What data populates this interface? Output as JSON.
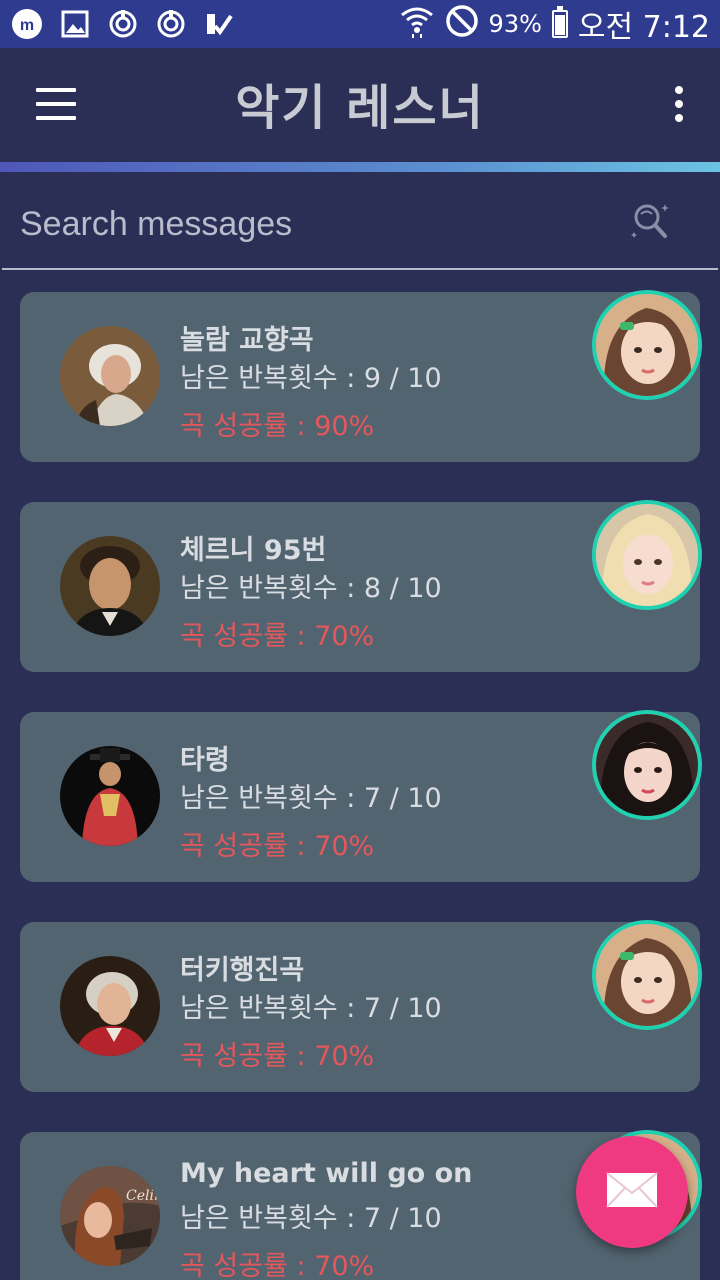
{
  "status_bar": {
    "battery": "93%",
    "time": "오전 7:12",
    "battery_level": 0.93,
    "icons": [
      "app-m-icon",
      "image-icon",
      "sync-icon",
      "sync-icon",
      "check-icon",
      "wifi-icon",
      "block-icon",
      "battery-icon"
    ]
  },
  "app_bar": {
    "title": "악기 레스너",
    "menu_icon": "hamburger-icon",
    "overflow_icon": "more-vert-icon"
  },
  "search": {
    "placeholder": "Search messages",
    "icon": "search-sparkle-icon"
  },
  "songs": [
    {
      "title": "놀람 교향곡",
      "remaining": "남은 반복횟수 : 9 / 10",
      "rate": "곡 성공률 : 90%"
    },
    {
      "title": "체르니 95번",
      "remaining": "남은 반복횟수 : 8 / 10",
      "rate": "곡 성공률 : 70%"
    },
    {
      "title": "타령",
      "remaining": "남은 반복횟수 : 7 / 10",
      "rate": "곡 성공률 : 70%"
    },
    {
      "title": "터키행진곡",
      "remaining": "남은 반복횟수 : 7 / 10",
      "rate": "곡 성공률 : 70%"
    },
    {
      "title": "My heart will go on",
      "remaining": "남은 반복횟수 : 7 / 10",
      "rate": "곡 성공률 : 70%"
    }
  ],
  "fab": {
    "icon": "mail-icon"
  },
  "colors": {
    "background": "#2b2f55",
    "status_bar": "#2f3b8f",
    "card": "#526470",
    "rate_text": "#e4575b",
    "avatar_ring": "#1fd1b1",
    "fab": "#ef3a82"
  }
}
